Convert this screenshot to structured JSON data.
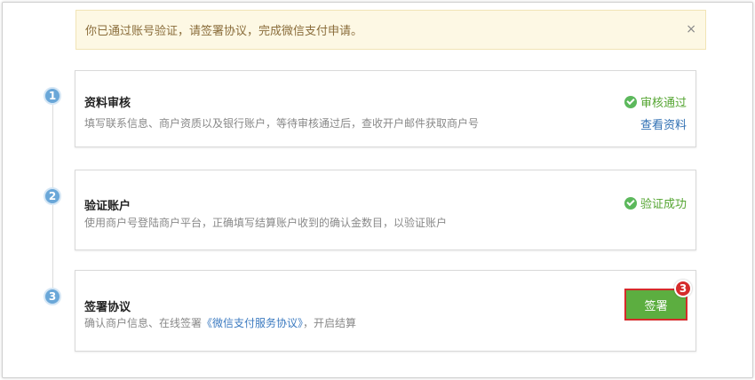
{
  "notice": {
    "text": "你已通过账号验证，请签署协议，完成微信支付申请。",
    "close_label": "×"
  },
  "steps": [
    {
      "number": "1",
      "title": "资料审核",
      "description": "填写联系信息、商户资质以及银行账户，等待审核通过后，查收开户邮件获取商户号",
      "status": "审核通过",
      "link": "查看资料"
    },
    {
      "number": "2",
      "title": "验证账户",
      "description": "使用商户号登陆商户平台，正确填写结算账户收到的确认金数目，以验证账户",
      "status": "验证成功"
    },
    {
      "number": "3",
      "title": "签署协议",
      "description_prefix": "确认商户信息、在线签署",
      "description_link": "《微信支付服务协议》",
      "description_suffix": "，开启结算",
      "button_label": "签署",
      "badge": "3"
    }
  ],
  "colors": {
    "accent_blue": "#6aa7d8",
    "success_green": "#55a532",
    "button_green": "#5cae40",
    "highlight_red": "#d52b2b",
    "notice_bg": "#fdf8e4"
  }
}
